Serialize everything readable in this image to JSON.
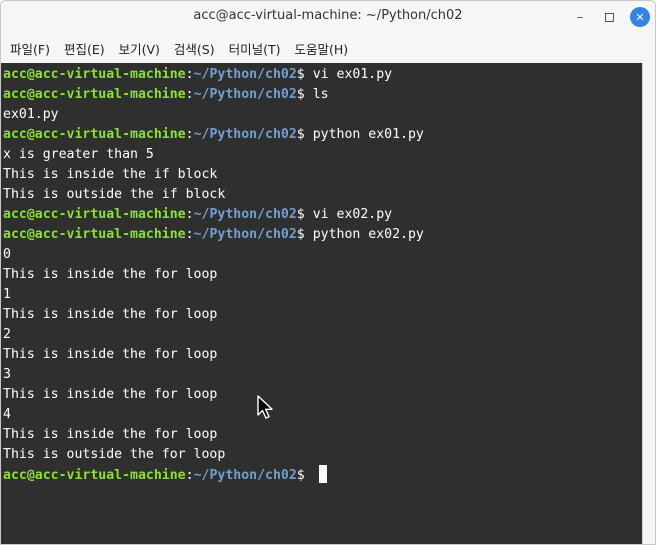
{
  "window": {
    "title": "acc@acc-virtual-machine: ~/Python/ch02"
  },
  "controls": {
    "minimize": "–",
    "close": "✕"
  },
  "menu": [
    "파일(F)",
    "편집(E)",
    "보기(V)",
    "검색(S)",
    "터미널(T)",
    "도움말(H)"
  ],
  "prompt": {
    "user": "acc@acc-virtual-machine",
    "sep": ":",
    "path": "~/Python/ch02",
    "dollar": "$"
  },
  "terminal": {
    "lines": [
      {
        "type": "prompt",
        "cmd": " vi ex01.py"
      },
      {
        "type": "prompt",
        "cmd": " ls"
      },
      {
        "type": "out",
        "text": "ex01.py"
      },
      {
        "type": "prompt",
        "cmd": " python ex01.py"
      },
      {
        "type": "out",
        "text": "x is greater than 5"
      },
      {
        "type": "out",
        "text": "This is inside the if block"
      },
      {
        "type": "out",
        "text": "This is outside the if block"
      },
      {
        "type": "prompt",
        "cmd": " vi ex02.py"
      },
      {
        "type": "prompt",
        "cmd": " python ex02.py"
      },
      {
        "type": "out",
        "text": "0"
      },
      {
        "type": "out",
        "text": "This is inside the for loop"
      },
      {
        "type": "out",
        "text": "1"
      },
      {
        "type": "out",
        "text": "This is inside the for loop"
      },
      {
        "type": "out",
        "text": "2"
      },
      {
        "type": "out",
        "text": "This is inside the for loop"
      },
      {
        "type": "out",
        "text": "3"
      },
      {
        "type": "out",
        "text": "This is inside the for loop"
      },
      {
        "type": "out",
        "text": "4"
      },
      {
        "type": "out",
        "text": "This is inside the for loop"
      },
      {
        "type": "out",
        "text": "This is outside the for loop"
      },
      {
        "type": "prompt",
        "cmd": " ",
        "cursor": true
      }
    ]
  },
  "colors": {
    "terminal_bg": "#2f2f2f",
    "user": "#8ae234",
    "path": "#729fcf",
    "text": "#ffffff",
    "close_button": "#3584e4"
  }
}
